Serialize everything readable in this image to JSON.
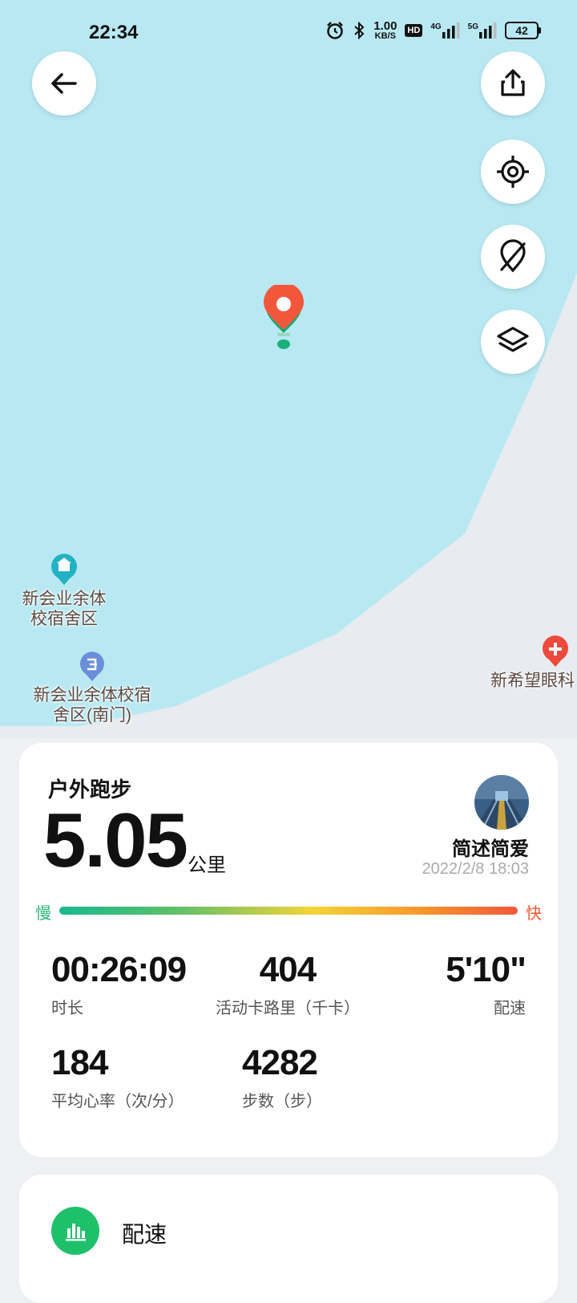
{
  "status_bar": {
    "time": "22:34",
    "net_speed_value": "1.00",
    "net_speed_unit": "KB/S",
    "hd_label": "HD",
    "signal1_label": "4G",
    "signal2_label": "5G",
    "battery": "42"
  },
  "map": {
    "pois": [
      {
        "name_line1": "新会业余体",
        "name_line2": "校宿舍区"
      },
      {
        "name_line1": "新会业余体校宿",
        "name_line2": "舍区(南门)"
      },
      {
        "name_line1": "新希望眼科",
        "name_line2": ""
      }
    ],
    "colors": {
      "water": "#b8e9f3",
      "land": "#e8ebf0",
      "route_pin": "#f2573c",
      "start_pin": "#19b07a"
    }
  },
  "summary": {
    "activity_type": "户外跑步",
    "distance": "5.05",
    "distance_unit": "公里",
    "username": "简述简爱",
    "datetime": "2022/2/8 18:03",
    "pace_scale_slow": "慢",
    "pace_scale_fast": "快",
    "metrics": {
      "duration": {
        "value": "00:26:09",
        "label": "时长"
      },
      "calories": {
        "value": "404",
        "label": "活动卡路里（千卡）"
      },
      "pace": {
        "value": "5'10\"",
        "label": "配速"
      },
      "heart_rate": {
        "value": "184",
        "label": "平均心率（次/分）"
      },
      "steps": {
        "value": "4282",
        "label": "步数（步）"
      }
    }
  },
  "pace_section": {
    "title": "配速"
  }
}
